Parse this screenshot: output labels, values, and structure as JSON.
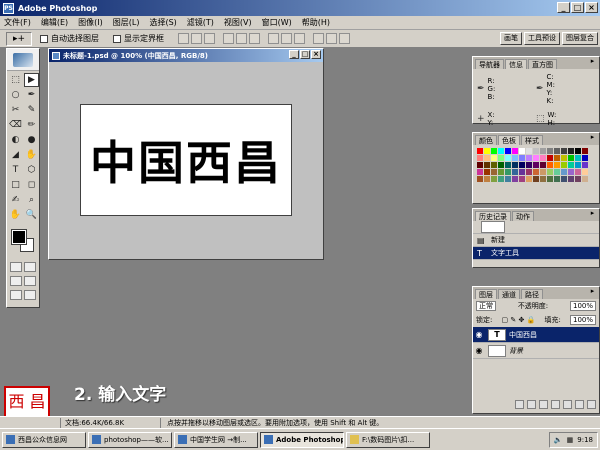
{
  "window": {
    "title": "Adobe Photoshop",
    "app_icon": "PS"
  },
  "window_buttons": {
    "minimize": "_",
    "maximize": "□",
    "close": "×"
  },
  "menus": [
    {
      "label": "文件(F)"
    },
    {
      "label": "编辑(E)"
    },
    {
      "label": "图像(I)"
    },
    {
      "label": "图层(L)"
    },
    {
      "label": "选择(S)"
    },
    {
      "label": "滤镜(T)"
    },
    {
      "label": "视图(V)"
    },
    {
      "label": "窗口(W)"
    },
    {
      "label": "帮助(H)"
    }
  ],
  "options_bar": {
    "tool_preset": "▸+",
    "auto_select_layer": "自动选择图层",
    "show_bounding_box": "显示定界框",
    "palette_well_tabs": [
      "画笔",
      "工具预设",
      "图层复合"
    ]
  },
  "toolbox": {
    "tools": [
      "⬚",
      "▶",
      "○",
      "✒",
      "✂",
      "✎",
      "⌫",
      "✏",
      "◐",
      "●",
      "◢",
      "✋",
      "T",
      "⬡",
      "□",
      "◻",
      "✍",
      "⌕",
      "✋",
      "🔍"
    ],
    "fg_color": "#000000",
    "bg_color": "#ffffff"
  },
  "document": {
    "title": "未标题-1.psd @ 100% (中国西昌, RGB/8)",
    "art_text": "中国西昌"
  },
  "navigator": {
    "tabs": [
      "导航器",
      "信息",
      "直方图"
    ],
    "rgb": "R:\nG:\nB:",
    "cmyk": "C:\nM:\nY:\nK:",
    "xy": "X:\nY:",
    "wh": "W:\nH:"
  },
  "swatches": {
    "tabs": [
      "颜色",
      "色板",
      "样式"
    ],
    "colors": [
      "#ff0000",
      "#ffff00",
      "#00ff00",
      "#00ffff",
      "#0000ff",
      "#ff00ff",
      "#ffffff",
      "#e0e0e0",
      "#c0c0c0",
      "#a0a0a0",
      "#808080",
      "#606060",
      "#404040",
      "#202020",
      "#000000",
      "#7f0000",
      "#ff7f7f",
      "#ffbf7f",
      "#ffff7f",
      "#7fff7f",
      "#7fffff",
      "#7fbfff",
      "#7f7fff",
      "#bf7fff",
      "#ff7fff",
      "#ff7fbf",
      "#c00000",
      "#c06000",
      "#c0c000",
      "#00c000",
      "#00c0c0",
      "#0000c0",
      "#600000",
      "#603000",
      "#606000",
      "#006000",
      "#006060",
      "#003060",
      "#000060",
      "#300060",
      "#600060",
      "#600030",
      "#ff6000",
      "#ff9900",
      "#99cc00",
      "#00cc99",
      "#0099cc",
      "#6633cc",
      "#cc3399",
      "#993300",
      "#996633",
      "#669933",
      "#339966",
      "#336699",
      "#663399",
      "#993366",
      "#cc6633",
      "#cc9966",
      "#99cc66",
      "#66cc99",
      "#6699cc",
      "#9966cc",
      "#cc6699",
      "#ffcc99",
      "#a05020",
      "#c08040",
      "#80a040",
      "#40a080",
      "#4080a0",
      "#8040a0",
      "#a04080",
      "#e0a060",
      "#704020",
      "#907040",
      "#507040",
      "#407050",
      "#405070",
      "#604070",
      "#704060",
      "#d0b090"
    ]
  },
  "history": {
    "tabs": [
      "历史记录",
      "动作"
    ],
    "snapshot_label": "",
    "items": [
      {
        "label": "新建"
      },
      {
        "label": "文字工具"
      }
    ]
  },
  "layers": {
    "tabs": [
      "图层",
      "通道",
      "路径"
    ],
    "blend_mode": "正常",
    "opacity_label": "不透明度:",
    "opacity_value": "100%",
    "lock_label": "锁定:",
    "fill_label": "填充:",
    "fill_value": "100%",
    "items": [
      {
        "name": "中国西昌",
        "thumb": "T",
        "selected": true
      },
      {
        "name": "背景",
        "thumb": "",
        "selected": false
      }
    ]
  },
  "caption": "2. 输入文字",
  "status": {
    "zoom": "",
    "doc_size": "文档:66.4K/66.8K",
    "hint": "点按并拖移以移动图层或选区。要用附加选项，使用 Shift 和 Alt 键。"
  },
  "taskbar": {
    "items": [
      {
        "label": "西昌公众信息网"
      },
      {
        "label": "photoshop——软..."
      },
      {
        "label": "中国学生网 →制..."
      },
      {
        "label": "Adobe Photoshop"
      },
      {
        "label": "F:\\数码图片\\扣..."
      }
    ],
    "clock": "9:18"
  }
}
